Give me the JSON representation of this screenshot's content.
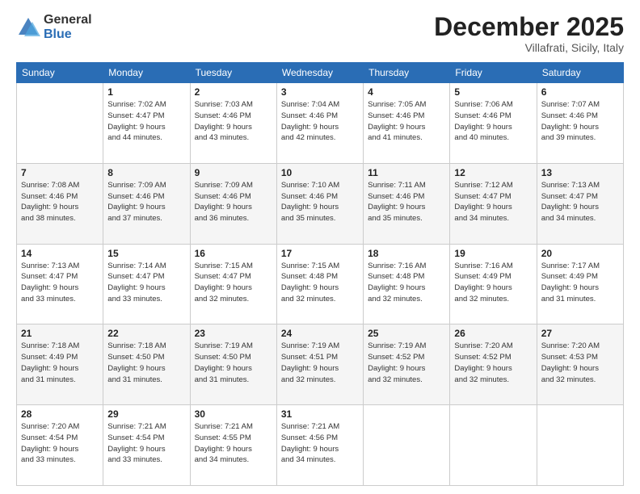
{
  "logo": {
    "general": "General",
    "blue": "Blue"
  },
  "header": {
    "month": "December 2025",
    "location": "Villafrati, Sicily, Italy"
  },
  "days_of_week": [
    "Sunday",
    "Monday",
    "Tuesday",
    "Wednesday",
    "Thursday",
    "Friday",
    "Saturday"
  ],
  "weeks": [
    [
      {
        "day": "",
        "sunrise": "",
        "sunset": "",
        "daylight": ""
      },
      {
        "day": "1",
        "sunrise": "Sunrise: 7:02 AM",
        "sunset": "Sunset: 4:47 PM",
        "daylight": "Daylight: 9 hours and 44 minutes."
      },
      {
        "day": "2",
        "sunrise": "Sunrise: 7:03 AM",
        "sunset": "Sunset: 4:46 PM",
        "daylight": "Daylight: 9 hours and 43 minutes."
      },
      {
        "day": "3",
        "sunrise": "Sunrise: 7:04 AM",
        "sunset": "Sunset: 4:46 PM",
        "daylight": "Daylight: 9 hours and 42 minutes."
      },
      {
        "day": "4",
        "sunrise": "Sunrise: 7:05 AM",
        "sunset": "Sunset: 4:46 PM",
        "daylight": "Daylight: 9 hours and 41 minutes."
      },
      {
        "day": "5",
        "sunrise": "Sunrise: 7:06 AM",
        "sunset": "Sunset: 4:46 PM",
        "daylight": "Daylight: 9 hours and 40 minutes."
      },
      {
        "day": "6",
        "sunrise": "Sunrise: 7:07 AM",
        "sunset": "Sunset: 4:46 PM",
        "daylight": "Daylight: 9 hours and 39 minutes."
      }
    ],
    [
      {
        "day": "7",
        "sunrise": "Sunrise: 7:08 AM",
        "sunset": "Sunset: 4:46 PM",
        "daylight": "Daylight: 9 hours and 38 minutes."
      },
      {
        "day": "8",
        "sunrise": "Sunrise: 7:09 AM",
        "sunset": "Sunset: 4:46 PM",
        "daylight": "Daylight: 9 hours and 37 minutes."
      },
      {
        "day": "9",
        "sunrise": "Sunrise: 7:09 AM",
        "sunset": "Sunset: 4:46 PM",
        "daylight": "Daylight: 9 hours and 36 minutes."
      },
      {
        "day": "10",
        "sunrise": "Sunrise: 7:10 AM",
        "sunset": "Sunset: 4:46 PM",
        "daylight": "Daylight: 9 hours and 35 minutes."
      },
      {
        "day": "11",
        "sunrise": "Sunrise: 7:11 AM",
        "sunset": "Sunset: 4:46 PM",
        "daylight": "Daylight: 9 hours and 35 minutes."
      },
      {
        "day": "12",
        "sunrise": "Sunrise: 7:12 AM",
        "sunset": "Sunset: 4:47 PM",
        "daylight": "Daylight: 9 hours and 34 minutes."
      },
      {
        "day": "13",
        "sunrise": "Sunrise: 7:13 AM",
        "sunset": "Sunset: 4:47 PM",
        "daylight": "Daylight: 9 hours and 34 minutes."
      }
    ],
    [
      {
        "day": "14",
        "sunrise": "Sunrise: 7:13 AM",
        "sunset": "Sunset: 4:47 PM",
        "daylight": "Daylight: 9 hours and 33 minutes."
      },
      {
        "day": "15",
        "sunrise": "Sunrise: 7:14 AM",
        "sunset": "Sunset: 4:47 PM",
        "daylight": "Daylight: 9 hours and 33 minutes."
      },
      {
        "day": "16",
        "sunrise": "Sunrise: 7:15 AM",
        "sunset": "Sunset: 4:47 PM",
        "daylight": "Daylight: 9 hours and 32 minutes."
      },
      {
        "day": "17",
        "sunrise": "Sunrise: 7:15 AM",
        "sunset": "Sunset: 4:48 PM",
        "daylight": "Daylight: 9 hours and 32 minutes."
      },
      {
        "day": "18",
        "sunrise": "Sunrise: 7:16 AM",
        "sunset": "Sunset: 4:48 PM",
        "daylight": "Daylight: 9 hours and 32 minutes."
      },
      {
        "day": "19",
        "sunrise": "Sunrise: 7:16 AM",
        "sunset": "Sunset: 4:49 PM",
        "daylight": "Daylight: 9 hours and 32 minutes."
      },
      {
        "day": "20",
        "sunrise": "Sunrise: 7:17 AM",
        "sunset": "Sunset: 4:49 PM",
        "daylight": "Daylight: 9 hours and 31 minutes."
      }
    ],
    [
      {
        "day": "21",
        "sunrise": "Sunrise: 7:18 AM",
        "sunset": "Sunset: 4:49 PM",
        "daylight": "Daylight: 9 hours and 31 minutes."
      },
      {
        "day": "22",
        "sunrise": "Sunrise: 7:18 AM",
        "sunset": "Sunset: 4:50 PM",
        "daylight": "Daylight: 9 hours and 31 minutes."
      },
      {
        "day": "23",
        "sunrise": "Sunrise: 7:19 AM",
        "sunset": "Sunset: 4:50 PM",
        "daylight": "Daylight: 9 hours and 31 minutes."
      },
      {
        "day": "24",
        "sunrise": "Sunrise: 7:19 AM",
        "sunset": "Sunset: 4:51 PM",
        "daylight": "Daylight: 9 hours and 32 minutes."
      },
      {
        "day": "25",
        "sunrise": "Sunrise: 7:19 AM",
        "sunset": "Sunset: 4:52 PM",
        "daylight": "Daylight: 9 hours and 32 minutes."
      },
      {
        "day": "26",
        "sunrise": "Sunrise: 7:20 AM",
        "sunset": "Sunset: 4:52 PM",
        "daylight": "Daylight: 9 hours and 32 minutes."
      },
      {
        "day": "27",
        "sunrise": "Sunrise: 7:20 AM",
        "sunset": "Sunset: 4:53 PM",
        "daylight": "Daylight: 9 hours and 32 minutes."
      }
    ],
    [
      {
        "day": "28",
        "sunrise": "Sunrise: 7:20 AM",
        "sunset": "Sunset: 4:54 PM",
        "daylight": "Daylight: 9 hours and 33 minutes."
      },
      {
        "day": "29",
        "sunrise": "Sunrise: 7:21 AM",
        "sunset": "Sunset: 4:54 PM",
        "daylight": "Daylight: 9 hours and 33 minutes."
      },
      {
        "day": "30",
        "sunrise": "Sunrise: 7:21 AM",
        "sunset": "Sunset: 4:55 PM",
        "daylight": "Daylight: 9 hours and 34 minutes."
      },
      {
        "day": "31",
        "sunrise": "Sunrise: 7:21 AM",
        "sunset": "Sunset: 4:56 PM",
        "daylight": "Daylight: 9 hours and 34 minutes."
      },
      {
        "day": "",
        "sunrise": "",
        "sunset": "",
        "daylight": ""
      },
      {
        "day": "",
        "sunrise": "",
        "sunset": "",
        "daylight": ""
      },
      {
        "day": "",
        "sunrise": "",
        "sunset": "",
        "daylight": ""
      }
    ]
  ]
}
